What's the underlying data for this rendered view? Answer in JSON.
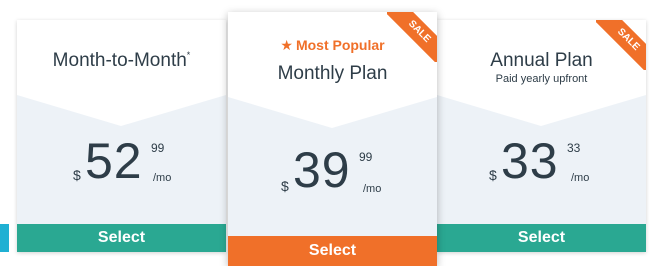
{
  "colors": {
    "teal": "#2aa892",
    "orange": "#f07029",
    "accent_blue": "#1fb0d3",
    "card_body": "#edf2f7"
  },
  "plans": [
    {
      "title": "Month-to-Month",
      "title_mark": "*",
      "currency": "$",
      "amount": "52",
      "cents": "99",
      "period": "/mo",
      "select_label": "Select"
    },
    {
      "popular_label": "Most Popular",
      "popular_icon": "star-icon",
      "title": "Monthly Plan",
      "currency": "$",
      "amount": "39",
      "cents": "99",
      "period": "/mo",
      "ribbon": "SALE",
      "select_label": "Select"
    },
    {
      "title": "Annual Plan",
      "subtitle": "Paid yearly upfront",
      "currency": "$",
      "amount": "33",
      "cents": "33",
      "period": "/mo",
      "ribbon": "SALE",
      "select_label": "Select"
    }
  ]
}
